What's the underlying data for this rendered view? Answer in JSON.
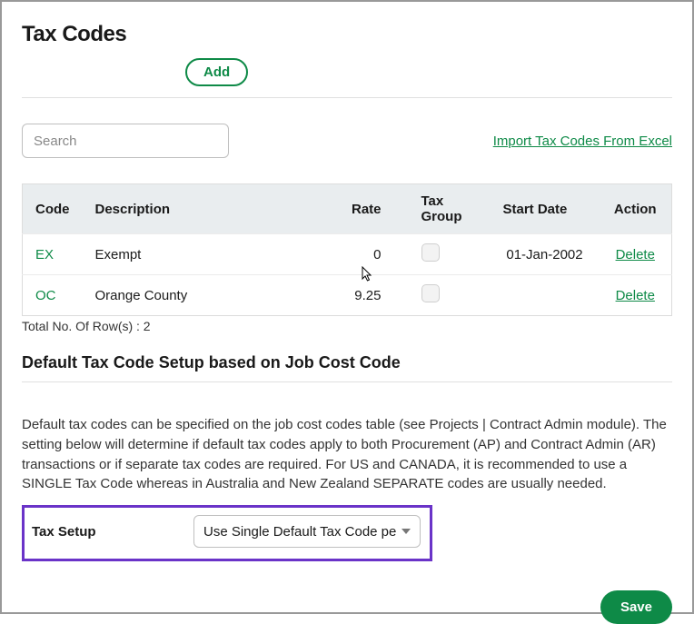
{
  "title": "Tax Codes",
  "add_label": "Add",
  "search_placeholder": "Search",
  "import_link": "Import Tax Codes From Excel",
  "table": {
    "headers": {
      "code": "Code",
      "description": "Description",
      "rate": "Rate",
      "tax_group": "Tax Group",
      "start_date": "Start Date",
      "action": "Action"
    },
    "rows": [
      {
        "code": "EX",
        "description": "Exempt",
        "rate": "0",
        "tax_group": false,
        "start_date": "01-Jan-2002",
        "action": "Delete"
      },
      {
        "code": "OC",
        "description": "Orange County",
        "rate": "9.25",
        "tax_group": false,
        "start_date": "",
        "action": "Delete"
      }
    ],
    "total_label": "Total No. Of Row(s) : 2"
  },
  "setup": {
    "heading": "Default Tax Code Setup based on Job Cost Code",
    "help": "Default tax codes can be specified on the job cost codes table (see Projects | Contract Admin module). The setting below will determine if default tax codes apply to both Procurement (AP) and Contract Admin (AR) transactions or if separate tax codes are required. For US and CANADA, it is recommended to use a SINGLE Tax Code whereas in Australia and New Zealand SEPARATE codes are usually needed.",
    "label": "Tax Setup",
    "selected": "Use Single Default Tax Code pe"
  },
  "save_label": "Save"
}
